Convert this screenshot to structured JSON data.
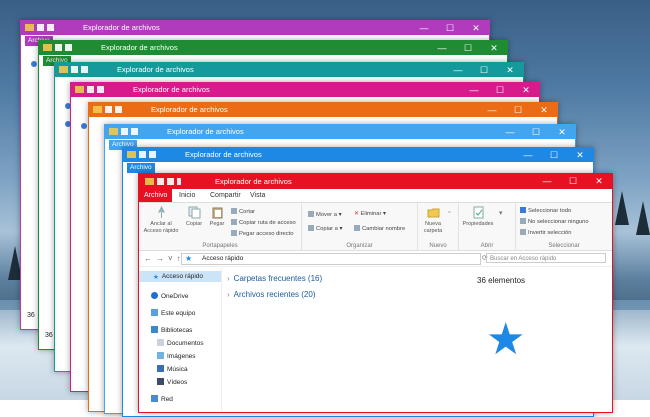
{
  "colors": {
    "win1": "#b03bbd",
    "win2": "#1f8c33",
    "win3": "#149a9a",
    "win4": "#d81b8c",
    "win5": "#ec6c16",
    "win6": "#42a5ee",
    "win7": "#1e88e5",
    "win8": "#e81123"
  },
  "window": {
    "title": "Explorador de archivos",
    "minimize": "—",
    "maximize": "☐",
    "close": "✕"
  },
  "background_windows": {
    "menu_file": "Archivo",
    "tabs": [
      "Inicio",
      "Compartir",
      "Vista"
    ],
    "count_label": "36"
  },
  "ribbon": {
    "tabs": [
      "Archivo",
      "Inicio",
      "Compartir",
      "Vista"
    ],
    "pin": "Anclar al Acceso rápido",
    "copy": "Copiar",
    "paste": "Pegar",
    "cut": "Cortar",
    "copy_path": "Copiar ruta de acceso",
    "paste_shortcut": "Pegar acceso directo",
    "move_to": "Mover a",
    "copy_to": "Copiar a",
    "delete": "Eliminar",
    "rename": "Cambiar nombre",
    "new_folder": "Nueva carpeta",
    "properties": "Propiedades",
    "select_all": "Seleccionar todo",
    "select_none": "No seleccionar ninguno",
    "invert": "Invertir selección",
    "groups": [
      "Portapapeles",
      "Organizar",
      "Nuevo",
      "Abrir",
      "Seleccionar"
    ]
  },
  "address": {
    "path": "Acceso rápido",
    "search_placeholder": "Buscar en Acceso rápido"
  },
  "sidebar": {
    "items": [
      "Acceso rápido",
      "OneDrive",
      "Este equipo",
      "Bibliotecas",
      "Documentos",
      "Imágenes",
      "Música",
      "Vídeos",
      "Red"
    ]
  },
  "content": {
    "groups": [
      "Carpetas frecuentes (16)",
      "Archivos recientes (20)"
    ],
    "count": "36 elementos"
  }
}
